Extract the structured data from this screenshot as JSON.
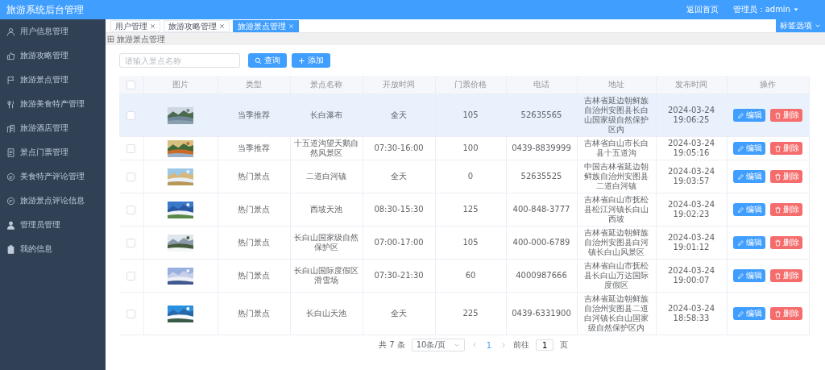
{
  "header": {
    "title": "旅游系统后台管理",
    "home_link": "返回首页",
    "user": "管理员：admin"
  },
  "sidebar": {
    "items": [
      {
        "label": "用户信息管理",
        "selected": false
      },
      {
        "label": "旅游攻略管理",
        "selected": false
      },
      {
        "label": "旅游景点管理",
        "selected": false
      },
      {
        "label": "旅游美食特产管理",
        "selected": false
      },
      {
        "label": "旅游酒店管理",
        "selected": false
      },
      {
        "label": "景点门票管理",
        "selected": false
      },
      {
        "label": "美食特产评论管理",
        "selected": false
      },
      {
        "label": "旅游景点评论信息",
        "selected": false
      },
      {
        "label": "管理员管理",
        "selected": false
      },
      {
        "label": "我的信息",
        "selected": false
      }
    ]
  },
  "tabs": [
    {
      "label": "用户管理",
      "selected": false
    },
    {
      "label": "旅游攻略管理",
      "selected": false
    },
    {
      "label": "旅游景点管理",
      "selected": true
    }
  ],
  "tab_options": "标签选项",
  "breadcrumb": "旅游景点管理",
  "search": {
    "placeholder": "请输入景点名称",
    "query_button": "查询",
    "add_button": "添加"
  },
  "table": {
    "all_checked": false,
    "columns": [
      "图片",
      "类型",
      "景点名称",
      "开放时间",
      "门票价格",
      "电话",
      "地址",
      "发布时间",
      "操作"
    ],
    "rows": [
      {
        "checked": false,
        "hovered": true,
        "type": "当季推荐",
        "name": "长白瀑布",
        "hours": "全天",
        "price": "105",
        "phone": "52635565",
        "address": "吉林省延边朝鲜族自治州安图县长白山国家级自然保护区内",
        "published": "2024-03-24 19:06:25",
        "edit_label": "编辑",
        "delete_label": "删除"
      },
      {
        "checked": false,
        "hovered": false,
        "type": "当季推荐",
        "name": "十五道沟望天鹅自然风景区",
        "hours": "07:30-16:00",
        "price": "100",
        "phone": "0439-8839999",
        "address": "吉林省白山市长白县十五道沟",
        "published": "2024-03-24 19:05:16",
        "edit_label": "编辑",
        "delete_label": "删除"
      },
      {
        "checked": false,
        "hovered": false,
        "type": "热门景点",
        "name": "二道白河镇",
        "hours": "全天",
        "price": "0",
        "phone": "52635525",
        "address": "中国吉林省延边朝鲜族自治州安图县二道白河镇",
        "published": "2024-03-24 19:03:57",
        "edit_label": "编辑",
        "delete_label": "删除"
      },
      {
        "checked": false,
        "hovered": false,
        "type": "热门景点",
        "name": "西坡天池",
        "hours": "08:30-15:30",
        "price": "125",
        "phone": "400-848-3777",
        "address": "吉林省白山市抚松县松江河镇长白山西坡",
        "published": "2024-03-24 19:02:23",
        "edit_label": "编辑",
        "delete_label": "删除"
      },
      {
        "checked": false,
        "hovered": false,
        "type": "热门景点",
        "name": "长白山国家级自然保护区",
        "hours": "07:00-17:00",
        "price": "105",
        "phone": "400-000-6789",
        "address": "吉林省延边朝鲜族自治州安图县白河镇长白山风景区",
        "published": "2024-03-24 19:01:12",
        "edit_label": "编辑",
        "delete_label": "删除"
      },
      {
        "checked": false,
        "hovered": false,
        "type": "热门景点",
        "name": "长白山国际度假区滑雪场",
        "hours": "07:30-21:30",
        "price": "60",
        "phone": "4000987666",
        "address": "吉林省白山市抚松县长白山万达国际度假区",
        "published": "2024-03-24 19:00:07",
        "edit_label": "编辑",
        "delete_label": "删除"
      },
      {
        "checked": false,
        "hovered": false,
        "type": "热门景点",
        "name": "长白山天池",
        "hours": "全天",
        "price": "225",
        "phone": "0439-6331900",
        "address": "吉林省延边朝鲜族自治州安图县二道白河镇长白山国家级自然保护区内",
        "published": "2024-03-24 18:58:33",
        "edit_label": "编辑",
        "delete_label": "删除"
      }
    ]
  },
  "pagination": {
    "total": "共 7 条",
    "page_size": "10条/页",
    "pages": [
      {
        "label": "1",
        "selected": true
      }
    ],
    "goto_label": "前往",
    "goto_value": "1",
    "page_suffix": "页"
  }
}
